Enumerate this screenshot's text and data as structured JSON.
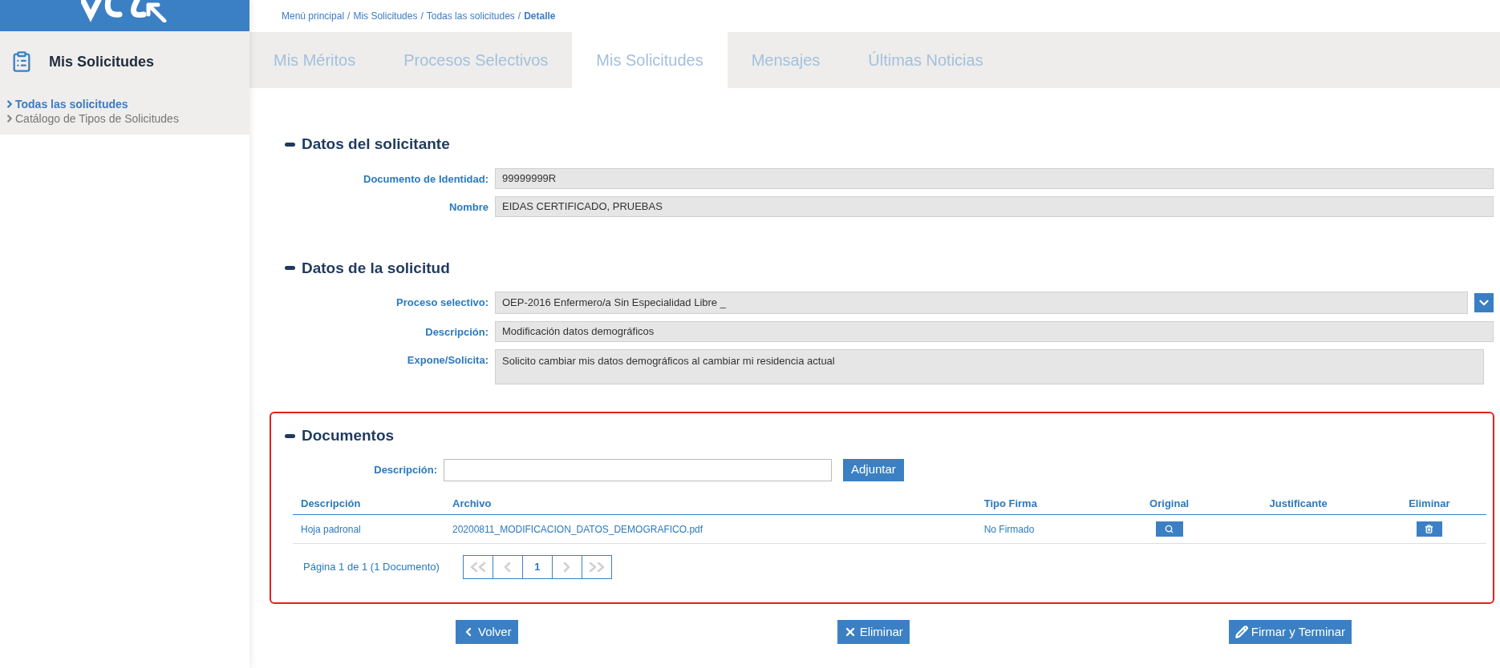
{
  "sidebar": {
    "title": "Mis Solicitudes",
    "items": [
      {
        "label": "Todas las solicitudes",
        "selected": true
      },
      {
        "label": "Catálogo de Tipos de Solicitudes",
        "selected": false
      }
    ]
  },
  "breadcrumb": [
    {
      "label": "Menú principal",
      "current": false
    },
    {
      "separator": "/",
      "label": "Mis Solicitudes",
      "current": false
    },
    {
      "separator": "/",
      "label": "Todas las solicitudes",
      "current": false
    },
    {
      "separator": "/",
      "label": "Detalle",
      "current": true
    }
  ],
  "tabs": [
    {
      "label": "Mis Méritos",
      "selected": false
    },
    {
      "label": "Procesos Selectivos",
      "selected": false
    },
    {
      "label": "Mis Solicitudes",
      "selected": true
    },
    {
      "label": "Mensajes",
      "selected": false
    },
    {
      "label": "Últimas Noticias",
      "selected": false
    }
  ],
  "sections": [
    {
      "title": "Datos del solicitante",
      "fields": [
        {
          "label": "Documento de Identidad:",
          "value": "99999999R",
          "kind": "text"
        },
        {
          "label": "Nombre",
          "value": "EIDAS CERTIFICADO, PRUEBAS",
          "kind": "text"
        }
      ]
    },
    {
      "title": "Datos de la solicitud",
      "fields": [
        {
          "label": "Proceso selectivo:",
          "value": "OEP-2016 Enfermero/a Sin Especialidad Libre _",
          "kind": "select"
        },
        {
          "label": "Descripción:",
          "value": "Modificación datos demográficos",
          "kind": "text"
        },
        {
          "label": "Expone/Solicita:",
          "value": "Solicito cambiar mis datos demográficos al cambiar mi residencia actual",
          "kind": "textarea"
        }
      ]
    }
  ],
  "documents": {
    "title": "Documentos",
    "upload": {
      "label": "Descripción:",
      "button": "Adjuntar"
    },
    "columns": [
      "Descripción",
      "Archivo",
      "Tipo Firma",
      "Original",
      "Justificante",
      "Eliminar"
    ],
    "rows": [
      {
        "descripcion": "Hoja padronal",
        "archivo": "20200811_MODIFICACION_DATOS_DEMOGRAFICO.pdf",
        "tipo_firma": "No Firmado"
      }
    ],
    "pagination": {
      "summary": "Página 1 de 1 (1 Documento)",
      "nav": [
        {
          "kind": "first",
          "disabled": true
        },
        {
          "kind": "prev",
          "disabled": true
        },
        {
          "kind": "page",
          "label": "1",
          "selected": true
        },
        {
          "kind": "next",
          "disabled": true
        },
        {
          "kind": "last",
          "disabled": true
        }
      ]
    }
  },
  "actions": [
    {
      "label": "Volver",
      "kind": "back"
    },
    {
      "label": "Eliminar",
      "kind": "delete"
    },
    {
      "label": "Firmar y Terminar",
      "kind": "sign"
    }
  ]
}
